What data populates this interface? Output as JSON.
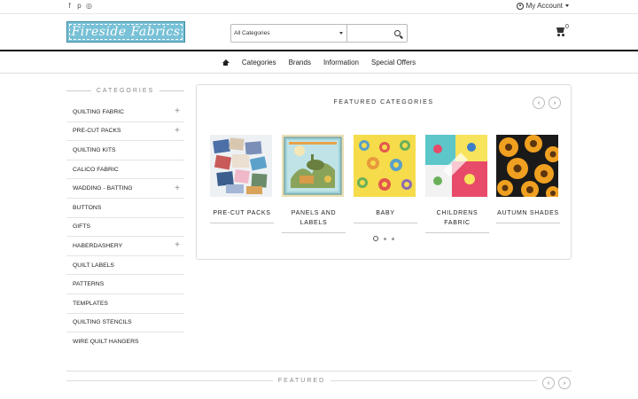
{
  "topbar": {
    "social_icons": [
      "facebook-icon",
      "pinterest-icon",
      "instagram-icon"
    ],
    "social_glyphs": [
      "f",
      "p",
      "◎"
    ],
    "account_label": "My Account"
  },
  "header": {
    "logo_text": "Fireside Fabrics",
    "search": {
      "category_value": "All Categories",
      "placeholder": ""
    },
    "cart_count": "0"
  },
  "nav": {
    "items": [
      "Categories",
      "Brands",
      "Information",
      "Special Offers"
    ]
  },
  "sidebar": {
    "heading": "CATEGORIES",
    "items": [
      {
        "label": "QUILTING FABRIC",
        "expand": "+"
      },
      {
        "label": "PRE-CUT PACKS",
        "expand": "+"
      },
      {
        "label": "QUILTING KITS",
        "expand": ""
      },
      {
        "label": "CALICO FABRIC",
        "expand": ""
      },
      {
        "label": "WADDING - BATTING",
        "expand": "+"
      },
      {
        "label": "BUTTONS",
        "expand": ""
      },
      {
        "label": "GIFTS",
        "expand": ""
      },
      {
        "label": "HABERDASHERY",
        "expand": "+"
      },
      {
        "label": "QUILT LABELS",
        "expand": ""
      },
      {
        "label": "PATTERNS",
        "expand": ""
      },
      {
        "label": "TEMPLATES",
        "expand": ""
      },
      {
        "label": "QUILTING STENCILS",
        "expand": ""
      },
      {
        "label": "WIRE QUILT HANGERS",
        "expand": ""
      }
    ]
  },
  "featured_categories": {
    "title": "FEATURED CATEGORIES",
    "prev": "‹",
    "next": "›",
    "tiles": [
      {
        "label": "PRE-CUT PACKS"
      },
      {
        "label": "PANELS AND LABELS"
      },
      {
        "label": "BABY"
      },
      {
        "label": "CHILDRENS FABRIC"
      },
      {
        "label": "AUTUMN SHADES"
      }
    ],
    "pages": 3,
    "active_page": 1
  },
  "featured": {
    "heading": "FEATURED",
    "prev": "‹",
    "next": "›"
  }
}
